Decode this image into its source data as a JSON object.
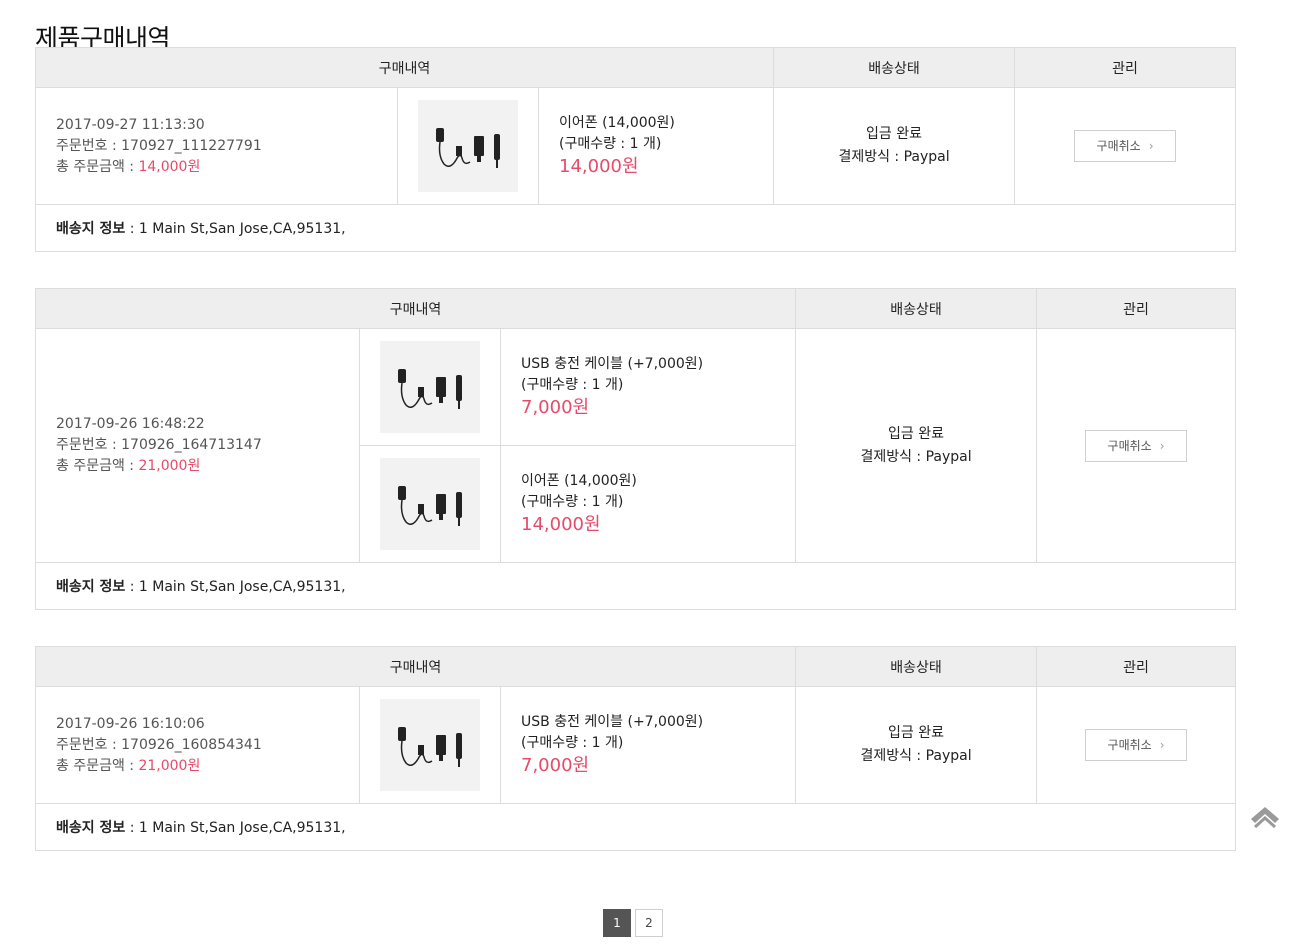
{
  "page": {
    "title": "제품구매내역"
  },
  "headers": {
    "purchase": "구매내역",
    "shipping": "배송상태",
    "manage": "관리"
  },
  "orders": [
    {
      "datetime": "2017-09-27 11:13:30",
      "order_no": "주문번호 : 170927_111227791",
      "total_label": "총 주문금액 : ",
      "total_value": "14,000원",
      "items": [
        {
          "name": "이어폰 (14,000원)",
          "qty": "(구매수량 : 1 개)",
          "price": "14,000원"
        }
      ],
      "status": "입금 완료",
      "payment": "결제방식 : Paypal",
      "cancel_label": "구매취소",
      "addr_label": "배송지 정보",
      "addr_value": " : 1 Main St,San Jose,CA,95131,"
    },
    {
      "datetime": "2017-09-26 16:48:22",
      "order_no": "주문번호 : 170926_164713147",
      "total_label": "총 주문금액 : ",
      "total_value": "21,000원",
      "items": [
        {
          "name": "USB 충전 케이블 (+7,000원)",
          "qty": "(구매수량 : 1 개)",
          "price": "7,000원"
        },
        {
          "name": "이어폰 (14,000원)",
          "qty": "(구매수량 : 1 개)",
          "price": "14,000원"
        }
      ],
      "status": "입금 완료",
      "payment": "결제방식 : Paypal",
      "cancel_label": "구매취소",
      "addr_label": "배송지 정보",
      "addr_value": " : 1 Main St,San Jose,CA,95131,"
    },
    {
      "datetime": "2017-09-26 16:10:06",
      "order_no": "주문번호 : 170926_160854341",
      "total_label": "총 주문금액 : ",
      "total_value": "21,000원",
      "items": [
        {
          "name": "USB 충전 케이블 (+7,000원)",
          "qty": "(구매수량 : 1 개)",
          "price": "7,000원"
        }
      ],
      "status": "입금 완료",
      "payment": "결제방식 : Paypal",
      "cancel_label": "구매취소",
      "addr_label": "배송지 정보",
      "addr_value": " : 1 Main St,San Jose,CA,95131,"
    }
  ],
  "pagination": {
    "pages": [
      "1",
      "2"
    ],
    "current": "1"
  },
  "icons": {
    "thumb": "charger-cable-product-image",
    "chevron": "chevron-right-icon",
    "top": "scroll-to-top-icon"
  },
  "colors": {
    "price": "#e84a6a",
    "header_bg": "#eeeeee",
    "active_page": "#555555"
  }
}
